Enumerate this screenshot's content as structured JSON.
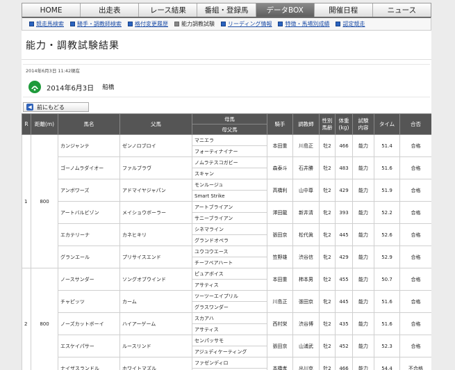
{
  "main_nav": [
    {
      "label": "HOME",
      "active": false
    },
    {
      "label": "出走表",
      "active": false
    },
    {
      "label": "レース結果",
      "active": false
    },
    {
      "label": "番組・登録馬",
      "active": false
    },
    {
      "label": "データBOX",
      "active": true
    },
    {
      "label": "開催日程",
      "active": false
    },
    {
      "label": "ニュース",
      "active": false
    }
  ],
  "sub_nav": [
    {
      "label": "競走馬検索",
      "current": false
    },
    {
      "label": "騎手・調教師検索",
      "current": false
    },
    {
      "label": "格付変更履歴",
      "current": false
    },
    {
      "label": "能力調教試験",
      "current": true
    },
    {
      "label": "リーディング情報",
      "current": false
    },
    {
      "label": "特徴・馬場別成績",
      "current": false
    },
    {
      "label": "認定競走",
      "current": false
    }
  ],
  "page_title": "能力・調教試験結果",
  "updated": "2014年6月3日 11:42現在",
  "race_date": "2014年6月3日",
  "venue": "船橋",
  "back_label": "前にもどる",
  "colors": {
    "active_tab": "#6b6b6b",
    "header": "#555555",
    "link": "#1f4fa8",
    "logo": "#1e9a3a"
  },
  "headers": {
    "r": "R",
    "dist": "距離(m)",
    "horse": "馬名",
    "sire": "父馬",
    "dam": "母馬",
    "damsire": "母父馬",
    "jockey": "騎手",
    "trainer": "調教師",
    "sexage": "性別\n馬齢",
    "weight": "体重\n(kg)",
    "kind": "試験\n内容",
    "time": "タイム",
    "result": "合否"
  },
  "groups": [
    {
      "r": "1",
      "dist": "800",
      "rows": [
        {
          "horse": "カンジャンテ",
          "sire": "ゼンノロブロイ",
          "dam": "マニエラ",
          "damsire": "フォーティナイナー",
          "jockey": "本田重",
          "trainer": "川島正",
          "sexage": "牡2",
          "weight": "466",
          "kind": "能力",
          "time": "51.4",
          "result": "合格"
        },
        {
          "horse": "ゴーノムラダイオー",
          "sire": "ファルブラヴ",
          "dam": "ノムラテスコガビー",
          "damsire": "スキャン",
          "jockey": "森泰斗",
          "trainer": "石井勝",
          "sexage": "牡2",
          "weight": "483",
          "kind": "能力",
          "time": "51.6",
          "result": "合格"
        },
        {
          "horse": "アンボワーズ",
          "sire": "アドマイヤジャパン",
          "dam": "モンルージュ",
          "damsire": "Smart Strike",
          "jockey": "高橋利",
          "trainer": "山中尊",
          "sexage": "牡2",
          "weight": "429",
          "kind": "能力",
          "time": "51.9",
          "result": "合格"
        },
        {
          "horse": "アートバルビゾン",
          "sire": "メイショウボーラー",
          "dam": "アートブライアン",
          "damsire": "サニーブライアン",
          "jockey": "澤田龍",
          "trainer": "新井清",
          "sexage": "牝2",
          "weight": "393",
          "kind": "能力",
          "time": "52.2",
          "result": "合格"
        },
        {
          "horse": "エカテリーナ",
          "sire": "カネヒキリ",
          "dam": "シネマライン",
          "damsire": "グランドオペラ",
          "jockey": "張田京",
          "trainer": "松代眞",
          "sexage": "牝2",
          "weight": "445",
          "kind": "能力",
          "time": "52.6",
          "result": "合格"
        },
        {
          "horse": "グランエール",
          "sire": "プリサイスエンド",
          "dam": "ユウコウエース",
          "damsire": "チーフベアハート",
          "jockey": "笠野雄",
          "trainer": "渋谷信",
          "sexage": "牝2",
          "weight": "429",
          "kind": "能力",
          "time": "52.9",
          "result": "合格"
        }
      ]
    },
    {
      "r": "2",
      "dist": "800",
      "rows": [
        {
          "horse": "ノースサンダー",
          "sire": "ソングオブウインド",
          "dam": "ピュアボイス",
          "damsire": "アサティス",
          "jockey": "本田重",
          "trainer": "柿本男",
          "sexage": "牡2",
          "weight": "455",
          "kind": "能力",
          "time": "50.7",
          "result": "合格"
        },
        {
          "horse": "チャピッツ",
          "sire": "カーム",
          "dam": "ツーツーエイプリル",
          "damsire": "グラスワンダー",
          "jockey": "川島正",
          "trainer": "張田京",
          "sexage": "牝2",
          "weight": "445",
          "kind": "能力",
          "time": "51.6",
          "result": "合格"
        },
        {
          "horse": "ノーズカットボーイ",
          "sire": "ハイアーゲーム",
          "dam": "スカアハ",
          "damsire": "アサティス",
          "jockey": "西村栄",
          "trainer": "渋谷博",
          "sexage": "牡2",
          "weight": "435",
          "kind": "能力",
          "time": "51.6",
          "result": "合格"
        },
        {
          "horse": "エスケイパサー",
          "sire": "ルースリンド",
          "dam": "センパッサモ",
          "damsire": "アジュディケーティング",
          "jockey": "張田京",
          "trainer": "山浦武",
          "sexage": "牡2",
          "weight": "452",
          "kind": "能力",
          "time": "52.3",
          "result": "合格"
        },
        {
          "horse": "ナイザスランドル",
          "sire": "ホワイトマズル",
          "dam": "ファゼンディロ",
          "damsire": "",
          "jockey": "本橋孝",
          "trainer": "出川克",
          "sexage": "牡2",
          "weight": "466",
          "kind": "能力",
          "time": "54.4",
          "result": "不合格"
        }
      ]
    }
  ]
}
